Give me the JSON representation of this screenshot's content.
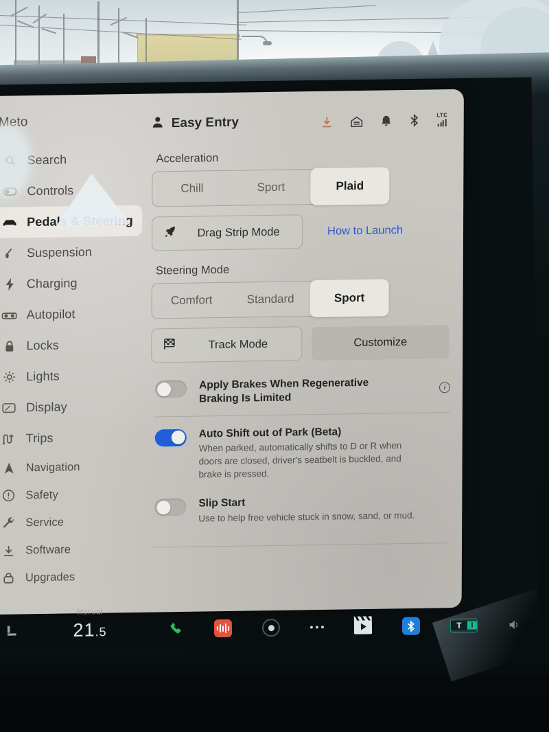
{
  "sidebar": {
    "profile_name": "Meto",
    "items": [
      {
        "label": "Search",
        "icon": "search-icon",
        "active": false
      },
      {
        "label": "Controls",
        "icon": "toggle-icon",
        "active": false
      },
      {
        "label": "Pedals & Steering",
        "icon": "car-icon",
        "active": true
      },
      {
        "label": "Suspension",
        "icon": "suspension-icon",
        "active": false
      },
      {
        "label": "Charging",
        "icon": "bolt-icon",
        "active": false
      },
      {
        "label": "Autopilot",
        "icon": "autopilot-icon",
        "active": false
      },
      {
        "label": "Locks",
        "icon": "lock-icon",
        "active": false
      },
      {
        "label": "Lights",
        "icon": "light-icon",
        "active": false
      },
      {
        "label": "Display",
        "icon": "display-icon",
        "active": false
      },
      {
        "label": "Trips",
        "icon": "trips-icon",
        "active": false
      },
      {
        "label": "Navigation",
        "icon": "navigation-icon",
        "active": false
      },
      {
        "label": "Safety",
        "icon": "safety-icon",
        "active": false
      },
      {
        "label": "Service",
        "icon": "wrench-icon",
        "active": false
      },
      {
        "label": "Software",
        "icon": "download-icon",
        "active": false
      },
      {
        "label": "Upgrades",
        "icon": "upgrades-icon",
        "active": false
      }
    ]
  },
  "topbar": {
    "driver_profile": "Easy Entry",
    "profile_icon": "person-icon",
    "status_icons": [
      {
        "name": "software-download-icon",
        "color": "#d4683a"
      },
      {
        "name": "glovebox-icon",
        "color": "#3b3b39"
      },
      {
        "name": "bell-icon",
        "color": "#3b3b39"
      },
      {
        "name": "bluetooth-icon",
        "color": "#3b3b39"
      }
    ],
    "network": {
      "label": "LTE",
      "bars": 4
    }
  },
  "main": {
    "acceleration": {
      "title": "Acceleration",
      "options": [
        "Chill",
        "Sport",
        "Plaid"
      ],
      "selected": "Plaid"
    },
    "drag_strip": {
      "label": "Drag Strip Mode",
      "icon": "rocket-icon",
      "link_label": "How to Launch"
    },
    "steering": {
      "title": "Steering Mode",
      "options": [
        "Comfort",
        "Standard",
        "Sport"
      ],
      "selected": "Sport"
    },
    "track": {
      "label": "Track Mode",
      "icon": "checkered-flag-icon",
      "customize_label": "Customize"
    },
    "toggles": [
      {
        "title": "Apply Brakes When Regenerative Braking Is Limited",
        "desc": "",
        "state": "off",
        "has_info": true
      },
      {
        "title": "Auto Shift out of Park (Beta)",
        "desc": "When parked, automatically shifts to D or R when doors are closed, driver's seatbelt is buckled, and brake is pressed.",
        "state": "on",
        "has_info": false
      },
      {
        "title": "Slip Start",
        "desc": "Use to help free vehicle stuck in snow, sand, or mud.",
        "state": "off",
        "has_info": false
      }
    ]
  },
  "taskbar": {
    "climate_mode": "Manual",
    "temperature_whole": "21",
    "temperature_fraction": ".5",
    "icons": [
      {
        "name": "seat-heater-icon"
      },
      {
        "name": "phone-icon"
      },
      {
        "name": "media-player-icon"
      },
      {
        "name": "dashcam-icon"
      },
      {
        "name": "app-launcher-icon"
      },
      {
        "name": "video-player-icon"
      },
      {
        "name": "bluetooth-icon"
      },
      {
        "name": "toybox-icon"
      },
      {
        "name": "volume-icon"
      }
    ]
  },
  "colors": {
    "panel_bg": "#c9c7c2",
    "accent_blue": "#1f5fd8",
    "link_blue": "#2f59c9",
    "download_orange": "#d4683a",
    "selected_seg": "#e9e7e2"
  }
}
